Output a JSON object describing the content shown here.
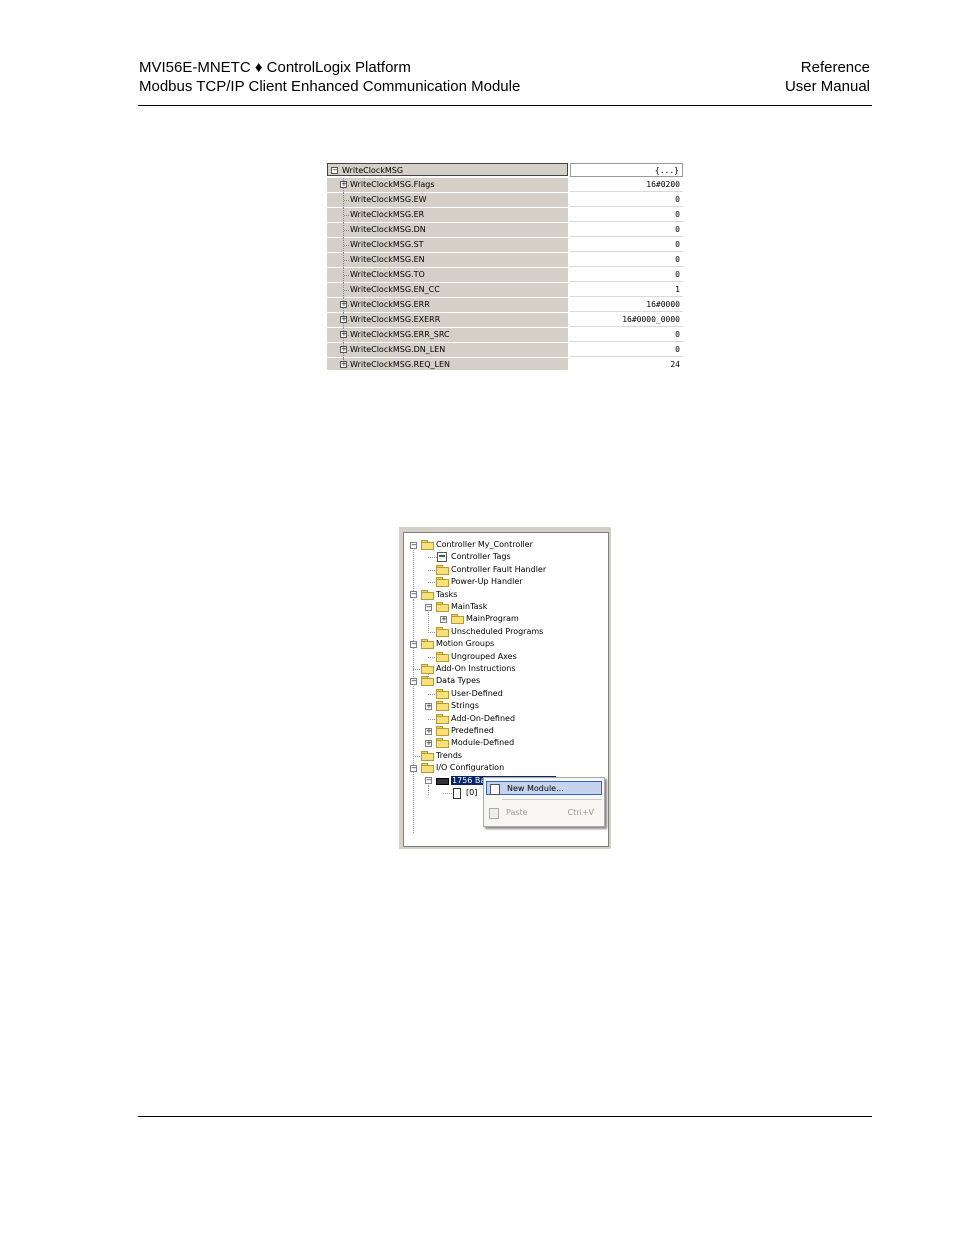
{
  "header": {
    "left_line1": "MVI56E-MNETC ♦ ControlLogix Platform",
    "left_line2": "Modbus TCP/IP Client Enhanced Communication Module",
    "right_line1": "Reference",
    "right_line2": "User Manual"
  },
  "tag_table": {
    "rows": [
      {
        "name": "WriteClockMSG",
        "value": "{...}",
        "expander": "−"
      },
      {
        "name": "WriteClockMSG.Flags",
        "value": "16#0200",
        "expander": "+"
      },
      {
        "name": "WriteClockMSG.EW",
        "value": "0",
        "expander": ""
      },
      {
        "name": "WriteClockMSG.ER",
        "value": "0",
        "expander": ""
      },
      {
        "name": "WriteClockMSG.DN",
        "value": "0",
        "expander": ""
      },
      {
        "name": "WriteClockMSG.ST",
        "value": "0",
        "expander": ""
      },
      {
        "name": "WriteClockMSG.EN",
        "value": "0",
        "expander": ""
      },
      {
        "name": "WriteClockMSG.TO",
        "value": "0",
        "expander": ""
      },
      {
        "name": "WriteClockMSG.EN_CC",
        "value": "1",
        "expander": ""
      },
      {
        "name": "WriteClockMSG.ERR",
        "value": "16#0000",
        "expander": "+"
      },
      {
        "name": "WriteClockMSG.EXERR",
        "value": "16#0000_0000",
        "expander": "+"
      },
      {
        "name": "WriteClockMSG.ERR_SRC",
        "value": "0",
        "expander": "+"
      },
      {
        "name": "WriteClockMSG.DN_LEN",
        "value": "0",
        "expander": "+"
      },
      {
        "name": "WriteClockMSG.REQ_LEN",
        "value": "24",
        "expander": "+"
      }
    ]
  },
  "organizer": {
    "items": [
      {
        "label": "Controller My_Controller",
        "level": 0,
        "expander": "−",
        "icon": "folder-icon"
      },
      {
        "label": "Controller Tags",
        "level": 1,
        "expander": "",
        "icon": "tags-icon"
      },
      {
        "label": "Controller Fault Handler",
        "level": 1,
        "expander": "",
        "icon": "folder-icon"
      },
      {
        "label": "Power-Up Handler",
        "level": 1,
        "expander": "",
        "icon": "folder-icon"
      },
      {
        "label": "Tasks",
        "level": 0,
        "expander": "−",
        "icon": "folder-icon"
      },
      {
        "label": "MainTask",
        "level": 1,
        "expander": "−",
        "icon": "task-icon"
      },
      {
        "label": "MainProgram",
        "level": 2,
        "expander": "+",
        "icon": "program-icon"
      },
      {
        "label": "Unscheduled Programs",
        "level": 1,
        "expander": "",
        "icon": "folder-icon"
      },
      {
        "label": "Motion Groups",
        "level": 0,
        "expander": "−",
        "icon": "folder-icon"
      },
      {
        "label": "Ungrouped Axes",
        "level": 1,
        "expander": "",
        "icon": "folder-icon"
      },
      {
        "label": "Add-On Instructions",
        "level": 0,
        "expander": "",
        "icon": "folder-icon"
      },
      {
        "label": "Data Types",
        "level": 0,
        "expander": "−",
        "icon": "folder-icon"
      },
      {
        "label": "User-Defined",
        "level": 1,
        "expander": "",
        "icon": "datatype-folder-icon"
      },
      {
        "label": "Strings",
        "level": 1,
        "expander": "+",
        "icon": "datatype-folder-icon"
      },
      {
        "label": "Add-On-Defined",
        "level": 1,
        "expander": "",
        "icon": "datatype-folder-icon"
      },
      {
        "label": "Predefined",
        "level": 1,
        "expander": "+",
        "icon": "datatype-folder-icon"
      },
      {
        "label": "Module-Defined",
        "level": 1,
        "expander": "+",
        "icon": "datatype-folder-icon"
      },
      {
        "label": "Trends",
        "level": 0,
        "expander": "",
        "icon": "folder-icon"
      },
      {
        "label": "I/O Configuration",
        "level": 0,
        "expander": "−",
        "icon": "folder-icon"
      },
      {
        "label": "1756 Backplane, 1756-A4",
        "level": 1,
        "expander": "−",
        "icon": "backplane-icon",
        "selected": true
      },
      {
        "label": "[0]",
        "level": 2,
        "expander": "",
        "icon": "controller-module-icon"
      }
    ],
    "context_menu": {
      "new_module_label": "New Module...",
      "paste_label": "Paste",
      "paste_shortcut": "Ctrl+V"
    }
  },
  "colors": {
    "selection": "#0a246a",
    "menu_highlight": "#c6d3ef",
    "folder_yellow": "#f7e27a",
    "grid_gray": "#d4d0c8"
  }
}
